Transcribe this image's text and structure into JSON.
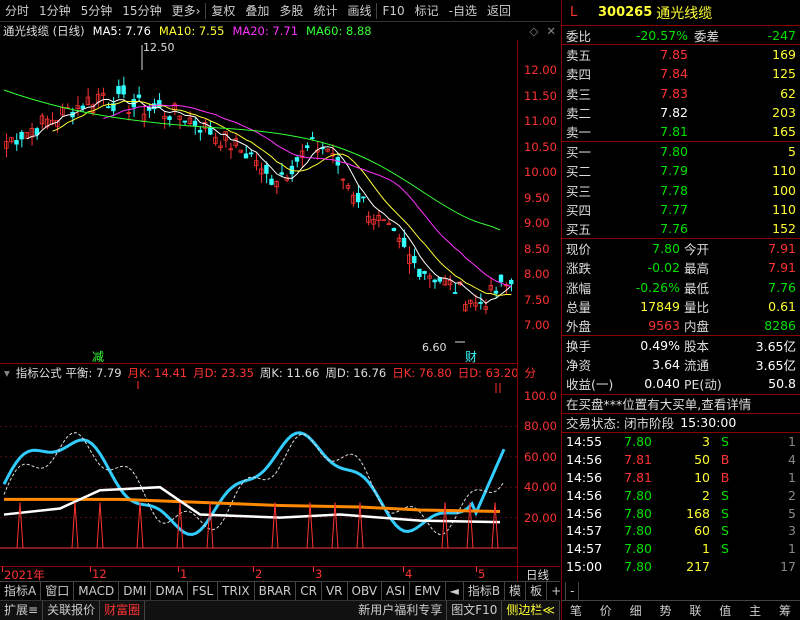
{
  "toolbar": {
    "items": [
      "分时",
      "1分钟",
      "5分钟",
      "15分钟",
      "更多›",
      "复权",
      "叠加",
      "多股",
      "统计",
      "画线",
      "F10",
      "标记",
      "-自选",
      "返回"
    ]
  },
  "chart": {
    "title": "通光线缆 (日线)",
    "ma_legend": [
      {
        "label": "MA5: 7.76",
        "color": "#ffffff"
      },
      {
        "label": "MA10: 7.55",
        "color": "#ffff33"
      },
      {
        "label": "MA20: 7.71",
        "color": "#ff33ff"
      },
      {
        "label": "MA60: 8.88",
        "color": "#33ff33"
      }
    ],
    "high_marker": "12.50",
    "low_marker": "6.60",
    "price_ticks": [
      "12.00",
      "11.50",
      "11.00",
      "10.50",
      "10.00",
      "9.50",
      "9.00",
      "8.50",
      "8.00",
      "7.50",
      "7.00"
    ],
    "label_jian": "减",
    "label_cai": "财",
    "indicator_title": "指标公式 平衡: 7.79",
    "indicator_values": [
      {
        "label": "月K: 14.41",
        "color": "#ff3333"
      },
      {
        "label": "月D: 23.35",
        "color": "#ff3333"
      },
      {
        "label": "周K: 11.66",
        "color": "#dddddd"
      },
      {
        "label": "周D: 16.76",
        "color": "#dddddd"
      },
      {
        "label": "日K: 76.80",
        "color": "#ff3333"
      },
      {
        "label": "日D: 63.20",
        "color": "#ff3333"
      },
      {
        "label": "分",
        "color": "#ff3333"
      }
    ],
    "indicator_ticks": [
      "100.0",
      "80.00",
      "60.00",
      "40.00",
      "20.00"
    ],
    "date_axis": [
      "2021年",
      "12",
      "1",
      "2",
      "3",
      "4",
      "5"
    ],
    "date_axis_right": "日线"
  },
  "tabs": [
    "指标A",
    "窗口",
    "MACD",
    "DMI",
    "DMA",
    "FSL",
    "TRIX",
    "BRAR",
    "CR",
    "VR",
    "OBV",
    "ASI",
    "EMV",
    "◄",
    "指标B",
    "模",
    "板",
    "+",
    "-"
  ],
  "bottom_bar": {
    "left": [
      "扩展≡",
      "关联报价",
      "财富圈"
    ],
    "right": [
      "新用户福利专享",
      "图文F10",
      "侧边栏≪"
    ]
  },
  "quote": {
    "flag": "L",
    "code": "300265",
    "name": "通光线缆",
    "weibi_label": "委比",
    "weibi": "-20.57%",
    "weicha_label": "委差",
    "weicha": "-247",
    "sell": [
      {
        "label": "卖五",
        "price": "7.85",
        "vol": "169"
      },
      {
        "label": "卖四",
        "price": "7.84",
        "vol": "125"
      },
      {
        "label": "卖三",
        "price": "7.83",
        "vol": "62"
      },
      {
        "label": "卖二",
        "price": "7.82",
        "vol": "203"
      },
      {
        "label": "卖一",
        "price": "7.81",
        "vol": "165"
      }
    ],
    "buy": [
      {
        "label": "买一",
        "price": "7.80",
        "vol": "5"
      },
      {
        "label": "买二",
        "price": "7.79",
        "vol": "110"
      },
      {
        "label": "买三",
        "price": "7.78",
        "vol": "100"
      },
      {
        "label": "买四",
        "price": "7.77",
        "vol": "110"
      },
      {
        "label": "买五",
        "price": "7.76",
        "vol": "152"
      }
    ],
    "stats": [
      {
        "l1": "现价",
        "v1": "7.80",
        "c1": "green",
        "l2": "今开",
        "v2": "7.91",
        "c2": "red"
      },
      {
        "l1": "涨跌",
        "v1": "-0.02",
        "c1": "green",
        "l2": "最高",
        "v2": "7.91",
        "c2": "red"
      },
      {
        "l1": "涨幅",
        "v1": "-0.26%",
        "c1": "green",
        "l2": "最低",
        "v2": "7.76",
        "c2": "green"
      },
      {
        "l1": "总量",
        "v1": "17849",
        "c1": "yellow",
        "l2": "量比",
        "v2": "0.61",
        "c2": "yellow"
      },
      {
        "l1": "外盘",
        "v1": "9563",
        "c1": "red",
        "l2": "内盘",
        "v2": "8286",
        "c2": "green"
      }
    ],
    "stats2": [
      {
        "l1": "换手",
        "v1": "0.49%",
        "l2": "股本",
        "v2": "3.65亿"
      },
      {
        "l1": "净资",
        "v1": "3.64",
        "l2": "流通",
        "v2": "3.65亿"
      },
      {
        "l1": "收益(一)",
        "v1": "0.040",
        "l2": "PE(动)",
        "v2": "50.8"
      }
    ],
    "notice": "在买盘***位置有大买单,查看详情",
    "status_label": "交易状态: 闭市阶段",
    "status_time": "15:30:00",
    "ticks": [
      {
        "time": "14:55",
        "price": "7.80",
        "vol": "3",
        "bs": "S",
        "n": "1"
      },
      {
        "time": "14:56",
        "price": "7.81",
        "vol": "50",
        "bs": "B",
        "n": "4"
      },
      {
        "time": "14:56",
        "price": "7.81",
        "vol": "10",
        "bs": "B",
        "n": "1"
      },
      {
        "time": "14:56",
        "price": "7.80",
        "vol": "2",
        "bs": "S",
        "n": "2"
      },
      {
        "time": "14:56",
        "price": "7.80",
        "vol": "168",
        "bs": "S",
        "n": "5"
      },
      {
        "time": "14:57",
        "price": "7.80",
        "vol": "60",
        "bs": "S",
        "n": "3"
      },
      {
        "time": "14:57",
        "price": "7.80",
        "vol": "1",
        "bs": "S",
        "n": "1"
      },
      {
        "time": "15:00",
        "price": "7.80",
        "vol": "217",
        "bs": "",
        "n": "17"
      }
    ],
    "bottom_tabs": [
      "笔",
      "价",
      "细",
      "势",
      "联",
      "值",
      "主",
      "筹"
    ]
  }
}
